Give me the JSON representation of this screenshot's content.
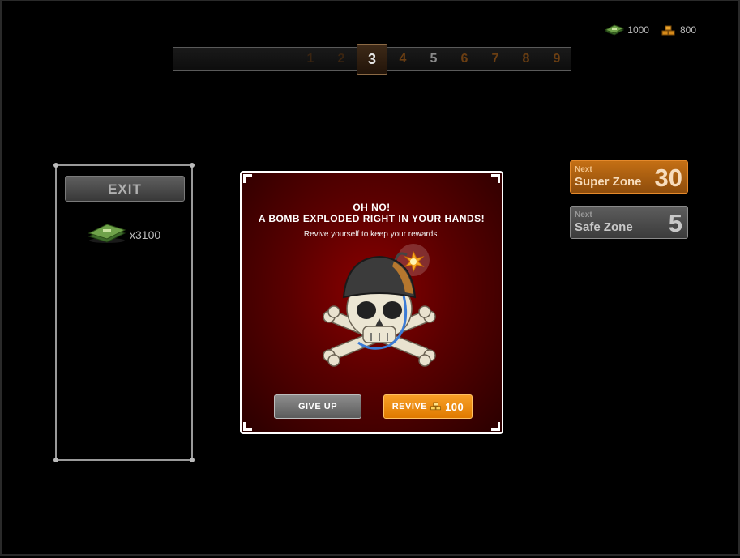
{
  "currency": [
    {
      "icon": "cash-stack-icon",
      "value": "1000"
    },
    {
      "icon": "gold-bars-icon",
      "value": "800"
    }
  ],
  "zones": {
    "current": "3",
    "items": [
      {
        "label": "1",
        "kind": "past"
      },
      {
        "label": "2",
        "kind": "past"
      },
      {
        "label": "3",
        "kind": "current"
      },
      {
        "label": "4",
        "kind": "super"
      },
      {
        "label": "5",
        "kind": "safe"
      },
      {
        "label": "6",
        "kind": "super"
      },
      {
        "label": "7",
        "kind": "super"
      },
      {
        "label": "8",
        "kind": "super"
      },
      {
        "label": "9",
        "kind": "super"
      }
    ]
  },
  "left_panel": {
    "exit_label": "EXIT",
    "reward_icon": "cash-stack-icon",
    "reward_text": "x3100"
  },
  "next_super": {
    "small": "Next",
    "label": "Super Zone",
    "number": "30"
  },
  "next_safe": {
    "small": "Next",
    "label": "Safe Zone",
    "number": "5"
  },
  "modal": {
    "title_line1": "OH NO!",
    "title_line2": "A BOMB EXPLODED RIGHT IN YOUR HANDS!",
    "subtitle": "Revive yourself to keep your rewards.",
    "give_up_label": "GIVE UP",
    "revive_label": "REVIVE",
    "revive_cost": "100",
    "revive_cost_icon": "gold-bars-icon"
  },
  "colors": {
    "super": "#c46f14",
    "safe": "#5d5d5d",
    "modal_bg": "#8a0000",
    "revive": "#f08c10"
  }
}
